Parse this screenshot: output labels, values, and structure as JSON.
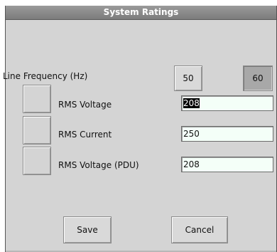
{
  "window": {
    "title": "System Ratings"
  },
  "line_frequency": {
    "label": "Line Frequency (Hz)",
    "options": [
      "50",
      "60"
    ],
    "selected": "60"
  },
  "rows": [
    {
      "label": "RMS Voltage",
      "value": "208",
      "selected_text": true
    },
    {
      "label": "RMS Current",
      "value": "250",
      "selected_text": false
    },
    {
      "label": "RMS Voltage (PDU)",
      "value": "208",
      "selected_text": false
    }
  ],
  "buttons": {
    "save": "Save",
    "cancel": "Cancel"
  }
}
